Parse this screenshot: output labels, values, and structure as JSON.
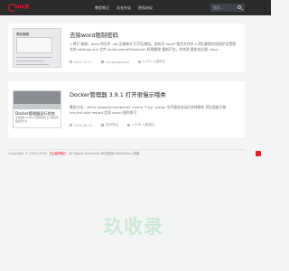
{
  "brand": {
    "logo_text": "Sun技"
  },
  "nav": {
    "items": [
      "教程笔记",
      "站长杂谈",
      "隐私协议"
    ]
  },
  "search": {
    "placeholder": "搜索..."
  },
  "posts": [
    {
      "title": "去除word限制密码",
      "excerpt": "1.将打 复制，docx 的文件 .zip 压缩格式 打开压缩包。若有为“word”相关文件夹 2.然后删除文档保护设置相关的 settings.xml 文件 w:documentProtection 权限解除 重新打包，并修改 重命名后缀 .docx",
      "date": "2022-12-17",
      "category": "Uncategorized",
      "views": "2,103 人围观过",
      "thumb_title": "限制编辑"
    },
    {
      "title": "Docker管理器 3.9.1 打开很慢示哦类",
      "excerpt": "事由方法：#find /www/server/panel/ -name \"*.py\" |xargs 令开服务启动后修改脚本 然后面板开放 /etc/init.d/bt restart 比如 panel 插件即可",
      "date": "2022-08-23",
      "category": "技术笔记",
      "views": "1,408 人围观过",
      "thumb_title": "Docker管理器运行状态",
      "thumb_sub": "宝塔面板 Docker 管理器插件 打开速度很慢处理方法"
    }
  ],
  "footer": {
    "text_prefix": "Copyright © 2020-2022",
    "site": "【山猫博客】",
    "text_suffix": "All Rights Reserved 本站使用 WordPress 搭建"
  },
  "watermark": "玖收录"
}
